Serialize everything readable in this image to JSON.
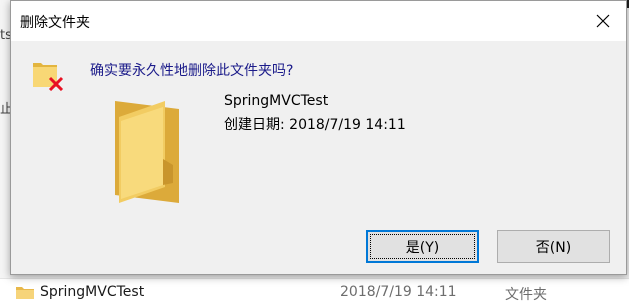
{
  "background": {
    "frag_top": "ts",
    "frag_mid": "止",
    "row": {
      "name": "SpringMVCTest",
      "date": "2018/7/19 14:11",
      "type": "文件夹"
    }
  },
  "dialog": {
    "title": "删除文件夹",
    "question": "确实要永久性地删除此文件夹吗?",
    "folder_name": "SpringMVCTest",
    "created_date": "创建日期: 2018/7/19 14:11",
    "yes_label": "是(Y)",
    "no_label": "否(N)"
  },
  "icons": [
    "close-icon",
    "folder-delete-icon",
    "folder-icon"
  ],
  "colors": {
    "question_text": "#1b1b8a",
    "focus_border": "#0078d7",
    "delete_x": "#e81123"
  }
}
